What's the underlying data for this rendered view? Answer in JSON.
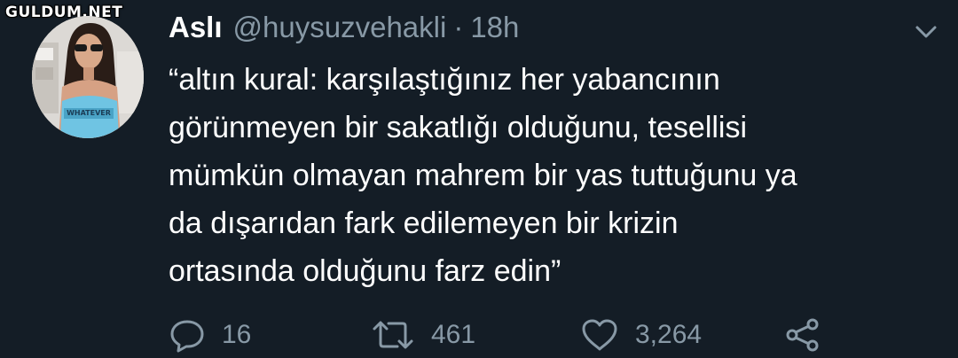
{
  "watermark": "GULDUM.NET",
  "tweet": {
    "author_name": "Aslı",
    "handle": "@huysuzvehakli",
    "separator": "·",
    "time": "18h",
    "text_lines": [
      "“altın kural: karşılaştığınız her yabancının",
      "görünmeyen bir sakatlığı olduğunu, tesellisi",
      "mümkün olmayan mahrem bir yas tuttuğunu ya",
      "da dışarıdan fark edilemeyen bir krizin",
      "ortasında olduğunu farz edin”"
    ],
    "avatar_shirt_text": "WHATEVER"
  },
  "actions": {
    "reply": {
      "icon": "reply-icon",
      "count": "16"
    },
    "retweet": {
      "icon": "retweet-icon",
      "count": "461"
    },
    "like": {
      "icon": "heart-icon",
      "count": "3,264"
    },
    "share": {
      "icon": "share-icon"
    }
  },
  "colors": {
    "background": "#141d26",
    "primary_text": "#ffffff",
    "secondary_text": "#8899a6"
  }
}
